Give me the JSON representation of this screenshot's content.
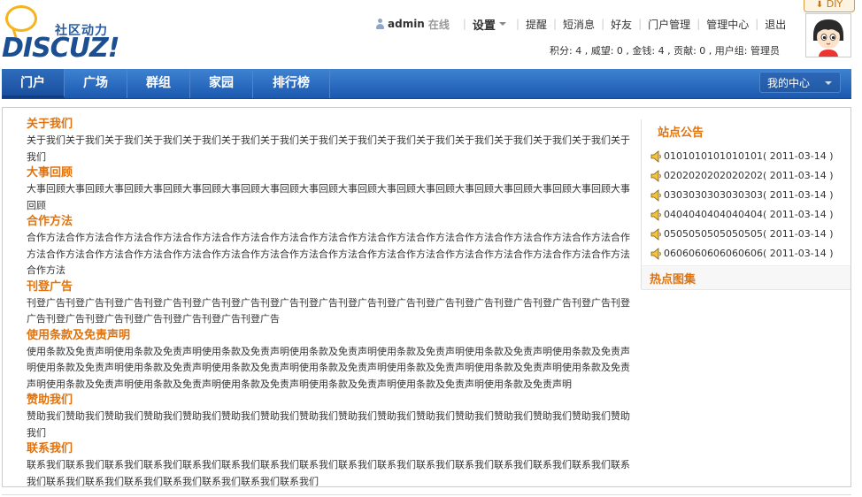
{
  "header": {
    "slogan": "社区动力",
    "logo_word": "DISCUZ!",
    "username": "admin",
    "online": "在线",
    "settings": "设置",
    "links": [
      "提醒",
      "短消息",
      "好友",
      "门户管理",
      "管理中心",
      "退出"
    ],
    "credits": "积分: 4 , 威望: 0 , 金钱: 4 , 贡献: 0 , 用户组: 管理员",
    "diy": "DIY"
  },
  "nav": {
    "items": [
      "门户",
      "广场",
      "群组",
      "家园",
      "排行榜"
    ],
    "active": "门户",
    "my_center": "我的中心"
  },
  "sections": [
    {
      "title": "关于我们",
      "body": "关于我们关于我们关于我们关于我们关于我们关于我们关于我们关于我们关于我们关于我们关于我们关于我们关于我们关于我们关于我们关于我们"
    },
    {
      "title": "大事回顾",
      "body": "大事回顾大事回顾大事回顾大事回顾大事回顾大事回顾大事回顾大事回顾大事回顾大事回顾大事回顾大事回顾大事回顾大事回顾大事回顾大事回顾"
    },
    {
      "title": "合作方法",
      "body": "合作方法合作方法合作方法合作方法合作方法合作方法合作方法合作方法合作方法合作方法合作方法合作方法合作方法合作方法合作方法合作方法合作方法合作方法合作方法合作方法合作方法合作方法合作方法合作方法合作方法合作方法合作方法合作方法合作方法合作方法合作方法合作方法"
    },
    {
      "title": "刊登广告",
      "body": "刊登广告刊登广告刊登广告刊登广告刊登广告刊登广告刊登广告刊登广告刊登广告刊登广告刊登广告刊登广告刊登广告刊登广告刊登广告刊登广告刊登广告刊登广告刊登广告刊登广告刊登广告刊登广告"
    },
    {
      "title": "使用条款及免责声明",
      "body": "使用条款及免责声明使用条款及免责声明使用条款及免责声明使用条款及免责声明使用条款及免责声明使用条款及免责声明使用条款及免责声明使用条款及免责声明使用条款及免责声明使用条款及免责声明使用条款及免责声明使用条款及免责声明使用条款及免责声明使用条款及免责声明使用条款及免责声明使用条款及免责声明使用条款及免责声明使用条款及免责声明使用条款及免责声明使用条款及免责声明"
    },
    {
      "title": "赞助我们",
      "body": "赞助我们赞助我们赞助我们赞助我们赞助我们赞助我们赞助我们赞助我们赞助我们赞助我们赞助我们赞助我们赞助我们赞助我们赞助我们赞助我们"
    },
    {
      "title": "联系我们",
      "body": "联系我们联系我们联系我们联系我们联系我们联系我们联系我们联系我们联系我们联系我们联系我们联系我们联系我们联系我们联系我们联系我们联系我们联系我们联系我们联系我们联系我们联系我们联系我们"
    }
  ],
  "sidebar": {
    "notice_title": "站点公告",
    "notices": [
      {
        "text": "0101010101010101",
        "date": "( 2011-03-14 )"
      },
      {
        "text": "0202020202020202",
        "date": "( 2011-03-14 )"
      },
      {
        "text": "0303030303030303",
        "date": "( 2011-03-14 )"
      },
      {
        "text": "0404040404040404",
        "date": "( 2011-03-14 )"
      },
      {
        "text": "0505050505050505",
        "date": "( 2011-03-14 )"
      },
      {
        "text": "0606060606060606",
        "date": "( 2011-03-14 )"
      }
    ],
    "hot_title": "热点图集"
  },
  "colors": {
    "accent": "#e2730c",
    "nav": "#1b59b0",
    "logo": "#1b4f92"
  }
}
